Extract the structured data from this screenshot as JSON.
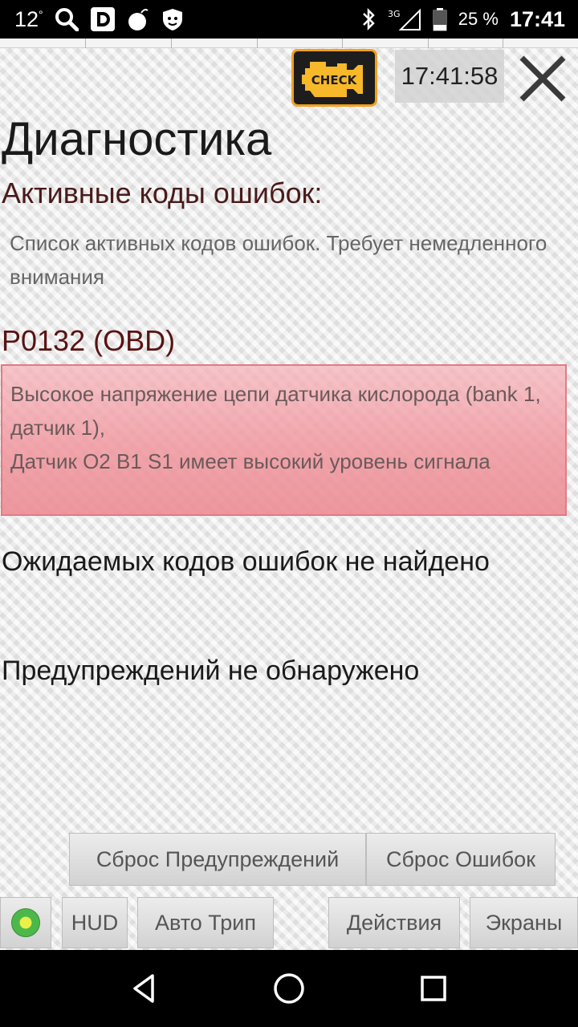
{
  "status_bar": {
    "temperature": "12",
    "degree": "°",
    "battery_percent": "25 %",
    "time": "17:41",
    "network": "3G"
  },
  "toolbar": {
    "check_label": "CHECK",
    "clock": "17:41:58"
  },
  "page": {
    "title": "Диагностика"
  },
  "active_codes": {
    "title": "Активные коды ошибок:",
    "description": "Список активных кодов ошибок. Требует немедленного внимания",
    "code": "P0132 (OBD)",
    "code_description_line1": "Высокое напряжение цепи датчика кислорода (bank 1, датчик 1),",
    "code_description_line2": "Датчик O2 B1 S1 имеет высокий уровень сигнала"
  },
  "pending_codes": {
    "text": "Ожидаемых кодов ошибок не найдено"
  },
  "warnings": {
    "text": "Предупреждений не обнаружено"
  },
  "buttons": {
    "reset_warnings": "Сброс Предупреждений",
    "reset_codes": "Сброс Ошибок",
    "hud": "HUD",
    "auto_trip": "Авто Трип",
    "actions": "Действия",
    "screens": "Экраны"
  },
  "colors": {
    "error_bg": "#f0969e",
    "error_border": "#e57a82",
    "check_border": "#f0a020",
    "check_icon": "#f7b82a",
    "status_dot": "#4cb84a"
  },
  "icons": {
    "status_bar": [
      "search-icon",
      "d-app-icon",
      "bomb-icon",
      "shield-lion-icon",
      "bluetooth-icon",
      "signal-icon",
      "battery-icon"
    ],
    "nav": [
      "back-icon",
      "home-icon",
      "recents-icon"
    ]
  }
}
